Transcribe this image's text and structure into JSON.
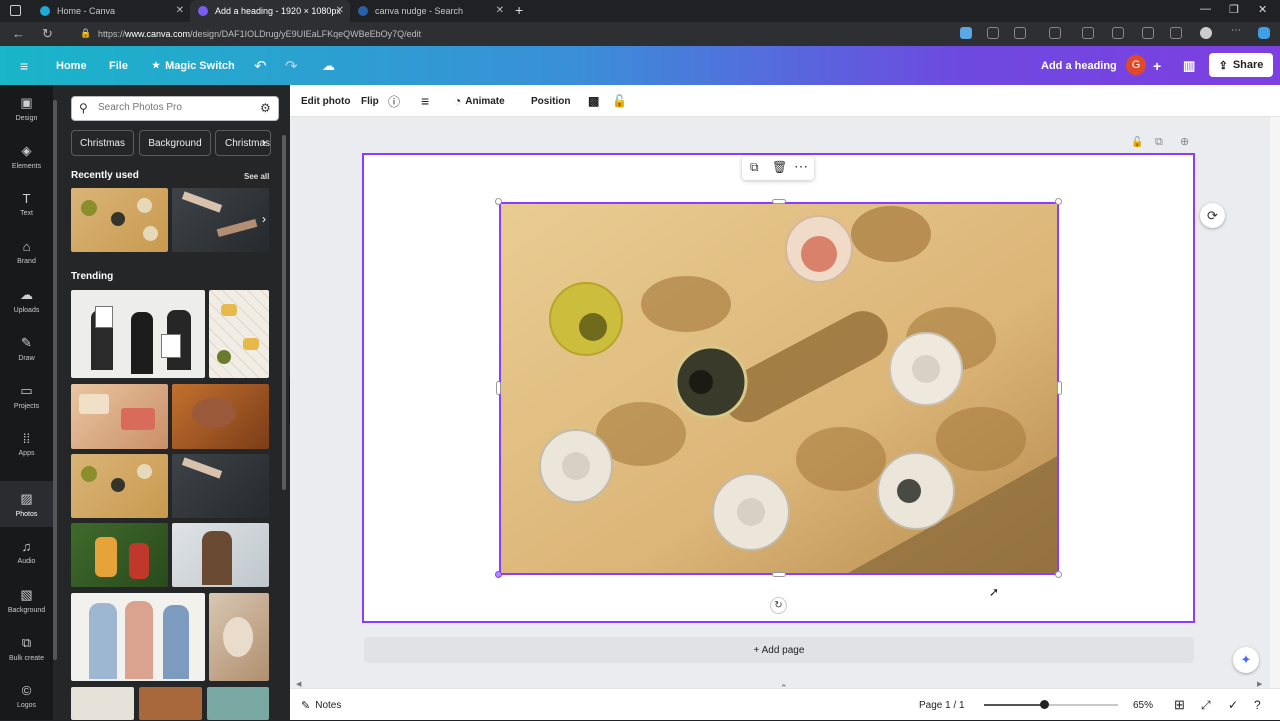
{
  "browser": {
    "tabs": [
      {
        "title": "Home - Canva",
        "active": false
      },
      {
        "title": "Add a heading - 1920 × 1080px",
        "active": true
      },
      {
        "title": "canva nudge - Search",
        "active": false
      }
    ],
    "url_prefix": "https://",
    "url_host": "www.canva.com",
    "url_path": "/design/DAF1IOLDrug/yE9UIEaLFKqeQWBeEbOy7Q/edit"
  },
  "header": {
    "home": "Home",
    "file": "File",
    "magic_switch": "Magic Switch",
    "design_title": "Add a heading",
    "avatar_initial": "G",
    "share": "Share"
  },
  "rail": [
    {
      "label": "Design",
      "icon": "▣"
    },
    {
      "label": "Elements",
      "icon": "◈"
    },
    {
      "label": "Text",
      "icon": "T"
    },
    {
      "label": "Brand",
      "icon": "⌂"
    },
    {
      "label": "Uploads",
      "icon": "☁"
    },
    {
      "label": "Draw",
      "icon": "✎"
    },
    {
      "label": "Projects",
      "icon": "▭"
    },
    {
      "label": "Apps",
      "icon": "⁞⁞"
    },
    {
      "label": "Photos",
      "icon": "▨"
    },
    {
      "label": "Audio",
      "icon": "♫"
    },
    {
      "label": "Background",
      "icon": "▧"
    },
    {
      "label": "Bulk create",
      "icon": "⧉"
    },
    {
      "label": "Logos",
      "icon": "©"
    }
  ],
  "panel": {
    "search_placeholder": "Search Photos Pro",
    "chips": [
      "Christmas",
      "Background",
      "Christmas"
    ],
    "recently_used": "Recently used",
    "see_all": "See all",
    "trending": "Trending"
  },
  "toolbar": {
    "edit_photo": "Edit photo",
    "flip": "Flip",
    "animate": "Animate",
    "position": "Position"
  },
  "canvas": {
    "add_page": "+ Add page"
  },
  "footer": {
    "notes": "Notes",
    "page_indicator": "Page 1 / 1",
    "zoom": "65%",
    "zoom_fraction": 0.45
  },
  "colors": {
    "accent": "#8b3dff",
    "header_start": "#19b5c8",
    "header_end": "#7d3fe0"
  }
}
